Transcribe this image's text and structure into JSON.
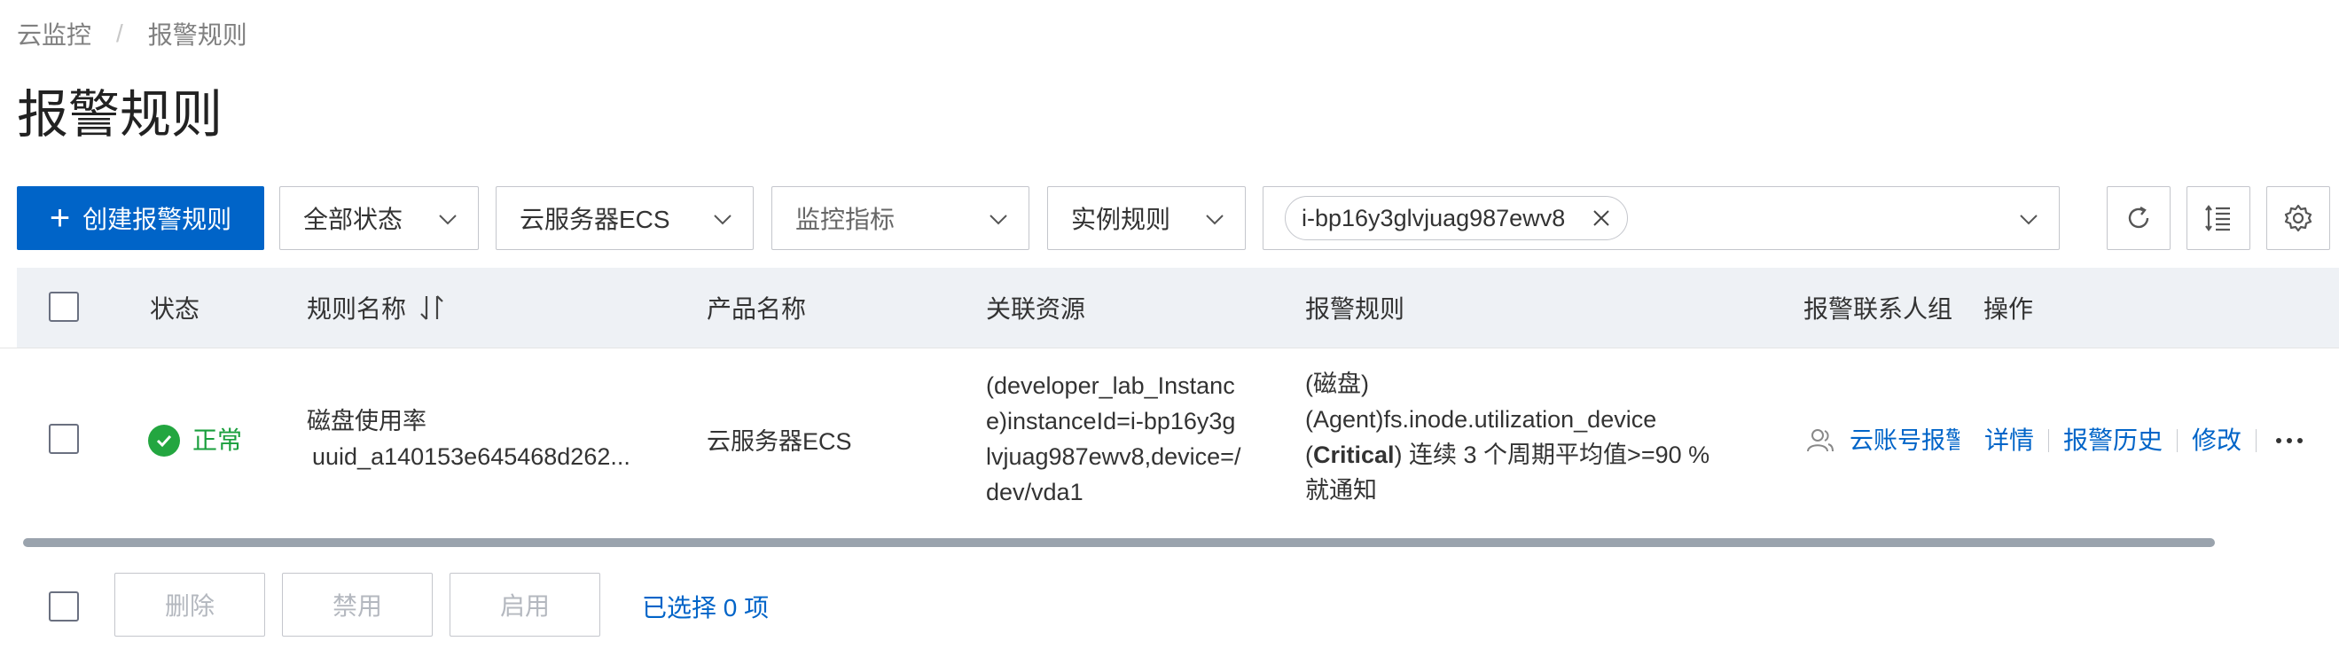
{
  "breadcrumb": {
    "root": "云监控",
    "separator": "/",
    "current": "报警规则"
  },
  "page_title": "报警规则",
  "toolbar": {
    "create_label": "创建报警规则",
    "status_select": "全部状态",
    "product_select": "云服务器ECS",
    "metric_select_placeholder": "监控指标",
    "rule_select": "实例规则",
    "search_tag": "i-bp16y3glvjuag987ewv8"
  },
  "table": {
    "headers": {
      "status": "状态",
      "rule_name": "规则名称",
      "product": "产品名称",
      "resource": "关联资源",
      "alarm_rule": "报警规则",
      "contact": "报警联系人组",
      "actions": "操作"
    },
    "rows": [
      {
        "status": "正常",
        "rule_name": "磁盘使用率",
        "rule_id": "uuid_a140153e645468d262...",
        "product": "云服务器ECS",
        "resource_lines": [
          "(developer_lab_Instanc",
          "e)instanceId=i-bp16y3g",
          "lvjuag987ewv8,device=/",
          "dev/vda1"
        ],
        "alarm_line1": "(磁盘)",
        "alarm_line2": "(Agent)fs.inode.utilization_device",
        "alarm_level": "Critical",
        "alarm_line3_rest": ") 连续 3 个周期平均值>=90 %",
        "alarm_line4": "就通知",
        "contact": "云账号报警",
        "actions": [
          "详情",
          "报警历史",
          "修改"
        ]
      }
    ]
  },
  "footer": {
    "delete": "删除",
    "disable": "禁用",
    "enable": "启用",
    "selected": "已选择 0 项"
  },
  "colors": {
    "primary": "#0064c8",
    "success": "#23a640",
    "header_bg": "#eef1f5"
  },
  "icons": [
    "plus-icon",
    "chevron-down-icon",
    "close-icon",
    "refresh-icon",
    "column-settings-icon",
    "gear-icon",
    "sort-icon",
    "check-circle-icon",
    "user-group-icon",
    "more-icon"
  ]
}
